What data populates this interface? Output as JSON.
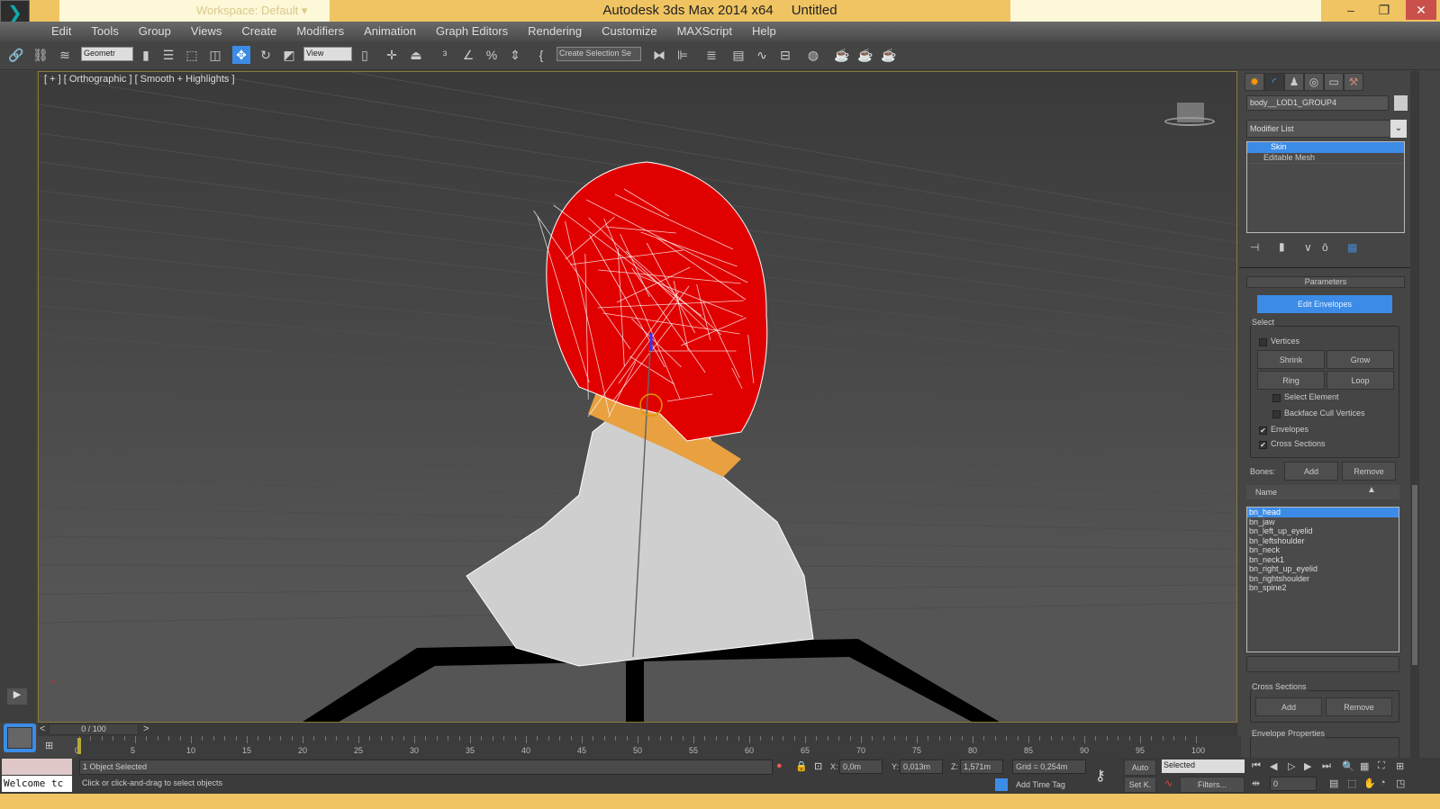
{
  "app": {
    "title": "Autodesk 3ds Max  2014 x64",
    "document": "Untitled",
    "workspace": "Workspace: Default"
  },
  "menus": [
    "Edit",
    "Tools",
    "Group",
    "Views",
    "Create",
    "Modifiers",
    "Animation",
    "Graph Editors",
    "Rendering",
    "Customize",
    "MAXScript",
    "Help"
  ],
  "toolbar": {
    "selection_filter": "Geometr",
    "ref_coord": "View",
    "named_selection": "Create Selection Se"
  },
  "viewport": {
    "label": "[ + ] [ Orthographic ] [ Smooth + Highlights ]",
    "accent": "#e00000"
  },
  "panel": {
    "object_name": "body__LOD1_GROUP4",
    "modifier_list": "Modifier List",
    "stack": [
      {
        "label": "Skin",
        "selected": true
      },
      {
        "label": "Editable Mesh",
        "selected": false
      }
    ],
    "rollout_title": "Parameters",
    "edit_envelopes": "Edit Envelopes",
    "select_group": "Select",
    "vertices": {
      "label": "Vertices",
      "checked": false
    },
    "shrink": "Shrink",
    "grow": "Grow",
    "ring": "Ring",
    "loop": "Loop",
    "select_element": {
      "label": "Select Element",
      "checked": false
    },
    "backface": {
      "label": "Backface Cull Vertices",
      "checked": false
    },
    "envelopes": {
      "label": "Envelopes",
      "checked": true
    },
    "cross_sections_cb": {
      "label": "Cross Sections",
      "checked": true
    },
    "bones_label": "Bones:",
    "add": "Add",
    "remove": "Remove",
    "name_header": "Name",
    "bones": [
      "bn_head",
      "bn_jaw",
      "bn_left_up_eyelid",
      "bn_leftshoulder",
      "bn_neck",
      "bn_neck1",
      "bn_right_up_eyelid",
      "bn_rightshoulder",
      "bn_spine2"
    ],
    "selected_bone": "bn_head",
    "cross_sections_group": "Cross Sections",
    "cs_add": "Add",
    "cs_remove": "Remove",
    "envelope_properties": "Envelope Properties"
  },
  "timeline": {
    "frame": "0 / 100",
    "ticks": [
      "0",
      "5",
      "10",
      "15",
      "20",
      "25",
      "30",
      "35",
      "40",
      "45",
      "50",
      "55",
      "60",
      "65",
      "70",
      "75",
      "80",
      "85",
      "90",
      "95",
      "100"
    ]
  },
  "status": {
    "maxscript": "Welcome tc",
    "selection": "1 Object Selected",
    "prompt": "Click or click-and-drag to select objects",
    "x_label": "X:",
    "x": "0,0m",
    "y_label": "Y:",
    "y": "0,013m",
    "z_label": "Z:",
    "z": "1,571m",
    "grid": "Grid = 0,254m",
    "add_time_tag": "Add Time Tag",
    "auto": "Auto",
    "set_key": "Set K.",
    "key_filter": "Selected",
    "filters": "Filters...",
    "current_frame": "0"
  }
}
